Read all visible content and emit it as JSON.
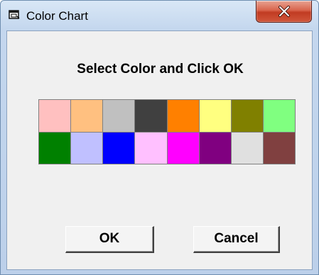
{
  "window": {
    "title": "Color Chart",
    "close_glyph": "X"
  },
  "dialog": {
    "heading": "Select Color and Click OK",
    "ok_label": "OK",
    "cancel_label": "Cancel"
  },
  "palette": {
    "colors": [
      "#ffc0c0",
      "#ffc080",
      "#c0c0c0",
      "#404040",
      "#ff8000",
      "#ffff80",
      "#808000",
      "#80ff80",
      "#008000",
      "#c0c0ff",
      "#0000ff",
      "#ffc0ff",
      "#ff00ff",
      "#800080",
      "#e0e0e0",
      "#804040"
    ]
  }
}
